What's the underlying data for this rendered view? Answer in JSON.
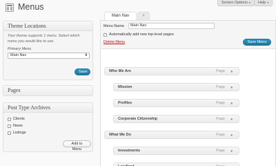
{
  "header": {
    "title": "Menus",
    "screen_options": "Screen Options",
    "help": "Help",
    "arrow": "▾"
  },
  "theme_locations": {
    "heading": "Theme Locations",
    "help_text": "Your theme supports 1 menu. Select which menu you would like to use.",
    "primary_label": "Primary Menu",
    "selected_menu": "Main Nav",
    "save_label": "Save"
  },
  "pages_box": {
    "heading": "Pages"
  },
  "post_type_archives": {
    "heading": "Post Type Archives",
    "items": [
      "Clients",
      "News",
      "Listings"
    ],
    "add_label": "Add to Menu"
  },
  "tabs": {
    "active": "Main Nav",
    "add": "+"
  },
  "editor": {
    "menu_name_label": "Menu Name",
    "menu_name_value": "Main Nav",
    "auto_add_label": "Automatically add new top-level pages",
    "delete_label": "Delete Menu",
    "save_label": "Save Menu"
  },
  "menu_items": [
    {
      "title": "Who We Are",
      "type": "Page",
      "depth": 0
    },
    {
      "title": "Mission",
      "type": "Page",
      "depth": 1
    },
    {
      "title": "Profiles",
      "type": "Page",
      "depth": 1
    },
    {
      "title": "Corporate Citizenship",
      "type": "Page",
      "depth": 1
    },
    {
      "title": "What We Do",
      "type": "Page",
      "depth": 0
    },
    {
      "title": "Investments",
      "type": "Page",
      "depth": 1
    },
    {
      "title": "Landlord",
      "type": "Page",
      "depth": 1
    }
  ],
  "icons": {
    "select_caret": "⬍",
    "item_toggle": "▼"
  },
  "colors": {
    "primary_button": "#21759b",
    "delete_link": "#bc0b0b"
  }
}
